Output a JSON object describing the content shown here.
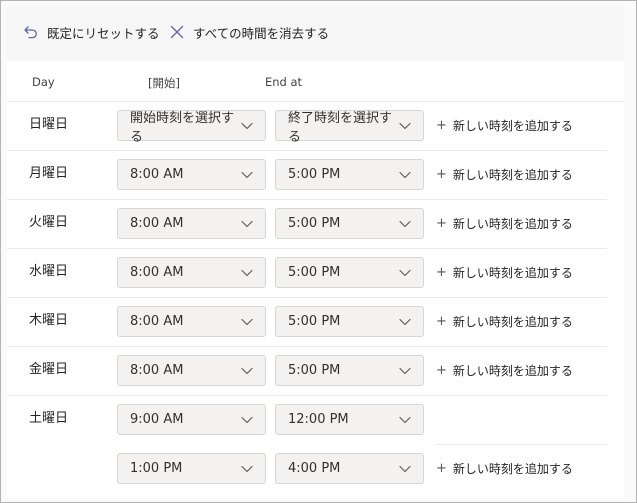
{
  "toolbar": {
    "reset_label": "既定にリセットする",
    "clear_label": "すべての時間を消去する"
  },
  "headers": {
    "day": "Day",
    "start": "[開始]",
    "end": "End at"
  },
  "add_label": "新しい時刻を追加する",
  "days": [
    {
      "name": "日曜日",
      "slots": [
        {
          "start": "開始時刻を選択する",
          "end": "終了時刻を選択する"
        }
      ]
    },
    {
      "name": "月曜日",
      "slots": [
        {
          "start": "8:00 AM",
          "end": "5:00 PM"
        }
      ]
    },
    {
      "name": "火曜日",
      "slots": [
        {
          "start": "8:00 AM",
          "end": "5:00 PM"
        }
      ]
    },
    {
      "name": "水曜日",
      "slots": [
        {
          "start": "8:00 AM",
          "end": "5:00 PM"
        }
      ]
    },
    {
      "name": "木曜日",
      "slots": [
        {
          "start": "8:00 AM",
          "end": "5:00 PM"
        }
      ]
    },
    {
      "name": "金曜日",
      "slots": [
        {
          "start": "8:00 AM",
          "end": "5:00 PM"
        }
      ]
    },
    {
      "name": "土曜日",
      "slots": [
        {
          "start": "9:00 AM",
          "end": "12:00 PM"
        },
        {
          "start": "1:00 PM",
          "end": "4:00 PM"
        }
      ]
    }
  ],
  "colors": {
    "accent": "#6264a7",
    "dropdown_bg": "#f3f2f1",
    "border": "#d6d6d6"
  }
}
